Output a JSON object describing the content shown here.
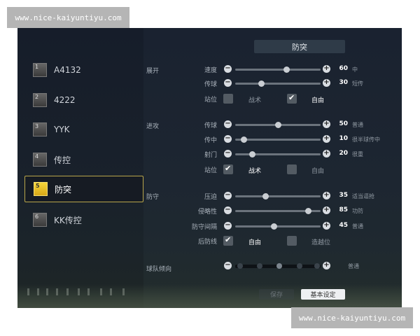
{
  "watermark": {
    "text": "www.nice-kaiyuntiyu.com"
  },
  "panel": {
    "title": "防突"
  },
  "teams": [
    {
      "num": "1",
      "name": "A4132",
      "selected": false
    },
    {
      "num": "2",
      "name": "4222",
      "selected": false
    },
    {
      "num": "3",
      "name": "YYK",
      "selected": false
    },
    {
      "num": "4",
      "name": "传控",
      "selected": false
    },
    {
      "num": "5",
      "name": "防突",
      "selected": true
    },
    {
      "num": "6",
      "name": "KK传控",
      "selected": false
    }
  ],
  "sections": {
    "buildup": "展开",
    "attack": "进攻",
    "defense": "防守",
    "orientation": "球队倾向"
  },
  "sliders": {
    "buildup_speed": {
      "label": "速度",
      "value": "60",
      "desc": "中",
      "level": 60
    },
    "buildup_pass": {
      "label": "传球",
      "value": "30",
      "desc": "短传",
      "level": 30
    },
    "attack_pass": {
      "label": "传球",
      "value": "50",
      "desc": "普通",
      "level": 50
    },
    "attack_cross": {
      "label": "传中",
      "value": "10",
      "desc": "很半球传中",
      "level": 10
    },
    "attack_shoot": {
      "label": "射门",
      "value": "20",
      "desc": "很重",
      "level": 20
    },
    "defense_pressure": {
      "label": "压迫",
      "value": "35",
      "desc": "适当逼抢",
      "level": 35
    },
    "defense_aggression": {
      "label": "侵略性",
      "value": "85",
      "desc": "功防",
      "level": 85
    },
    "defense_width": {
      "label": "防守间隔",
      "value": "45",
      "desc": "普通",
      "level": 45
    },
    "orientation": {
      "desc": "普通"
    }
  },
  "checks": {
    "buildup_pos": {
      "label": "站位",
      "opt1": "战术",
      "opt2": "自由",
      "opt1_checked": false,
      "opt2_checked": true
    },
    "attack_pos": {
      "label": "站位",
      "opt1": "战术",
      "opt2": "自由",
      "opt1_checked": true,
      "opt2_checked": false
    },
    "defense_line": {
      "label": "后防线",
      "opt1": "自由",
      "opt2": "造越位",
      "opt1_checked": true,
      "opt2_checked": false
    }
  },
  "buttons": {
    "save": "保存",
    "basic": "基本设定"
  }
}
